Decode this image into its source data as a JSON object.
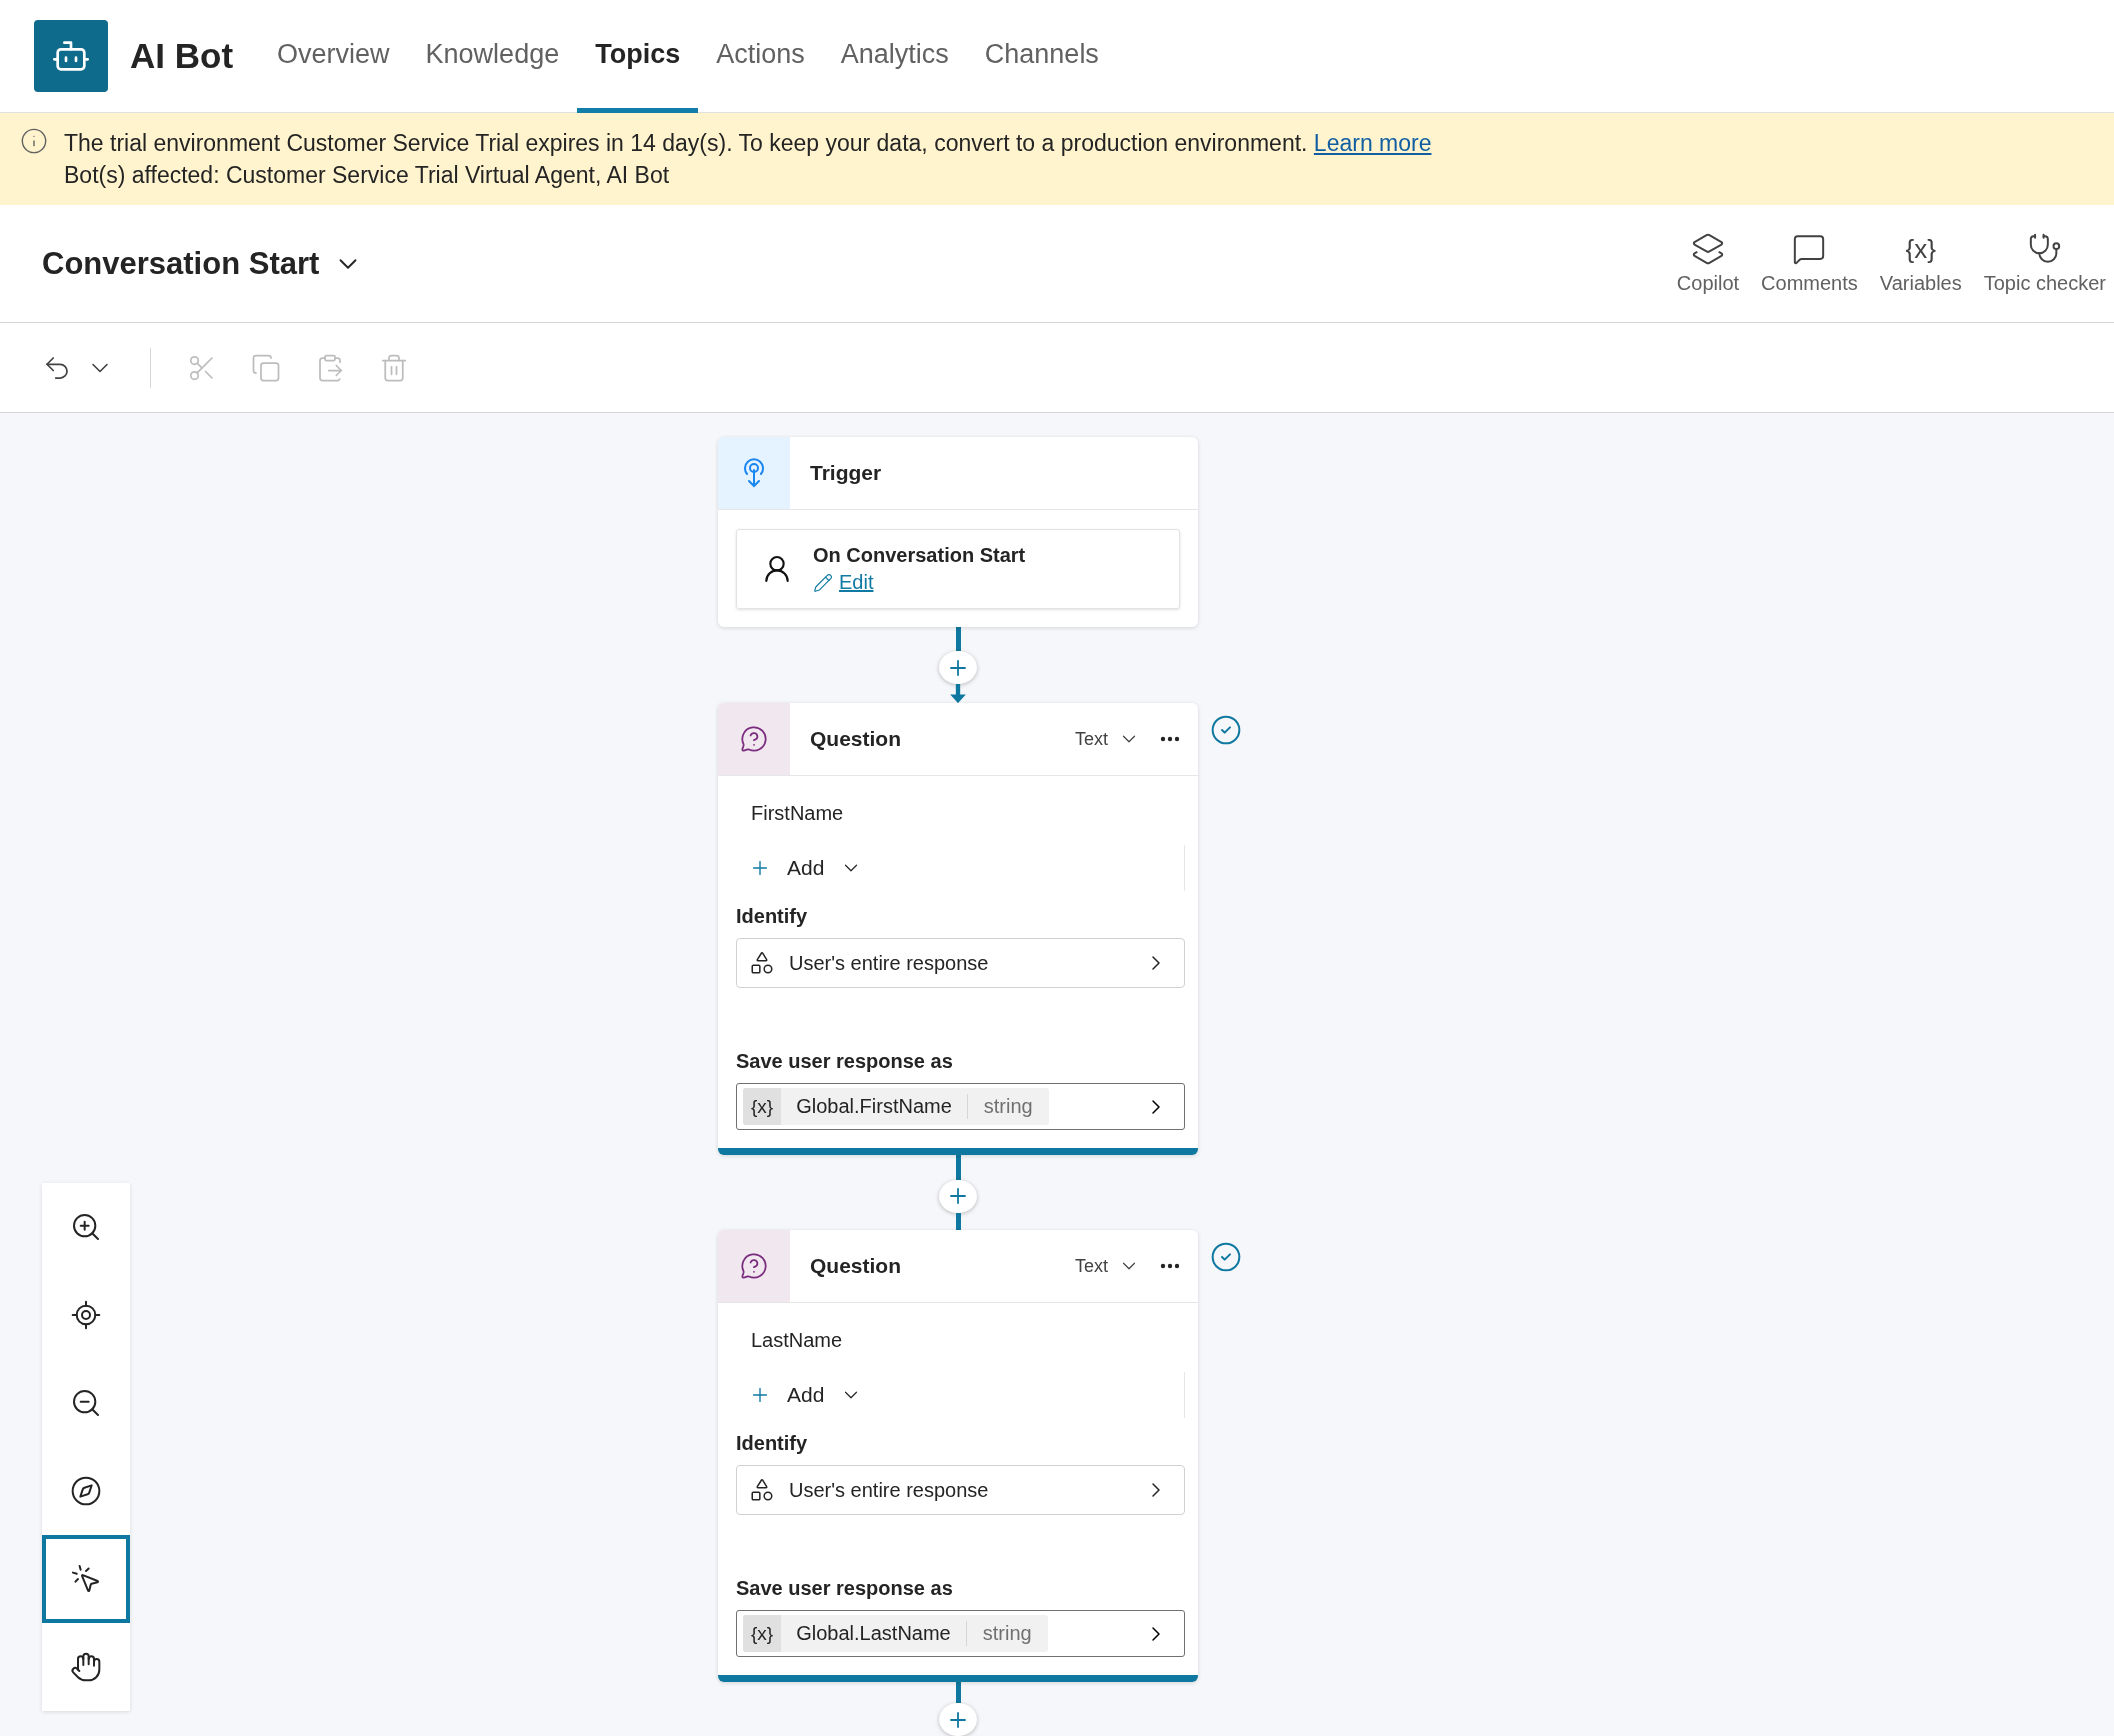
{
  "app": {
    "name": "AI Bot"
  },
  "tabs": [
    {
      "label": "Overview",
      "selected": false
    },
    {
      "label": "Knowledge",
      "selected": false
    },
    {
      "label": "Topics",
      "selected": true
    },
    {
      "label": "Actions",
      "selected": false
    },
    {
      "label": "Analytics",
      "selected": false
    },
    {
      "label": "Channels",
      "selected": false
    }
  ],
  "banner": {
    "message": "The trial environment Customer Service Trial expires in 14 day(s). To keep your data, convert to a production environment.",
    "link": "Learn more",
    "affected": "Bot(s) affected: Customer Service Trial Virtual Agent, AI Bot"
  },
  "topic": {
    "title": "Conversation Start"
  },
  "tools": [
    {
      "kind": "copilot",
      "label": "Copilot"
    },
    {
      "kind": "comments",
      "label": "Comments"
    },
    {
      "kind": "variables",
      "label": "Variables",
      "glyph": "{x}"
    },
    {
      "kind": "checker",
      "label": "Topic checker"
    }
  ],
  "edit_actions": [
    {
      "kind": "undo",
      "disabled": false
    },
    {
      "kind": "cut",
      "disabled": true
    },
    {
      "kind": "copy",
      "disabled": true
    },
    {
      "kind": "paste",
      "disabled": true
    },
    {
      "kind": "delete",
      "disabled": true
    }
  ],
  "trigger": {
    "header": "Trigger",
    "event": "On Conversation Start",
    "edit_link": "Edit"
  },
  "questions": [
    {
      "header": "Question",
      "type": "Text",
      "prompt": "FirstName",
      "add_label": "Add",
      "identify_label": "Identify",
      "identify_value": "User's entire response",
      "save_label": "Save user response as",
      "var_glyph": "{x}",
      "variable": "Global.FirstName",
      "variable_type": "string",
      "valid": true
    },
    {
      "header": "Question",
      "type": "Text",
      "prompt": "LastName",
      "add_label": "Add",
      "identify_label": "Identify",
      "identify_value": "User's entire response",
      "save_label": "Save user response as",
      "var_glyph": "{x}",
      "variable": "Global.LastName",
      "variable_type": "string",
      "valid": true
    }
  ],
  "canvas_controls": [
    {
      "kind": "zoom-in",
      "selected": false
    },
    {
      "kind": "recenter",
      "selected": false
    },
    {
      "kind": "zoom-out",
      "selected": false
    },
    {
      "kind": "minimap",
      "selected": false
    },
    {
      "kind": "select",
      "selected": true
    },
    {
      "kind": "pan",
      "selected": false
    }
  ]
}
